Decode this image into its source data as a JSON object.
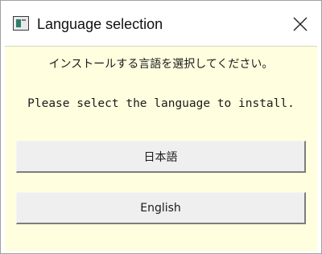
{
  "window": {
    "title": "Language selection",
    "icon": "application-window-icon",
    "close_icon": "close-icon"
  },
  "content": {
    "message_ja": "インストールする言語を選択してください。",
    "message_en": "Please select the language to install.",
    "buttons": [
      {
        "label": "日本語"
      },
      {
        "label": "English"
      }
    ]
  },
  "colors": {
    "content_background": "#fffedf",
    "button_face": "#efefef",
    "title_background": "#ffffff"
  }
}
